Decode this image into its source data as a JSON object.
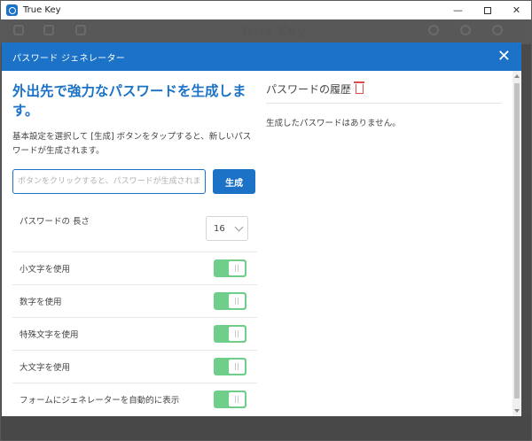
{
  "window": {
    "title": "True Key"
  },
  "background": {
    "logo_text": "True Key"
  },
  "dialog": {
    "title": "パスワード ジェネレーター",
    "heading": "外出先で強力なパスワードを生成します。",
    "description": "基本設定を選択して [生成] ボタンをタップすると、新しいパスワードが生成されます。",
    "input_placeholder": "ボタンをクリックすると、パスワードが生成されます",
    "generate_label": "生成",
    "length": {
      "label": "パスワードの 長さ",
      "value": "16"
    },
    "options": [
      {
        "label": "小文字を使用",
        "enabled": true
      },
      {
        "label": "数字を使用",
        "enabled": true
      },
      {
        "label": "特殊文字を使用",
        "enabled": true
      },
      {
        "label": "大文字を使用",
        "enabled": true
      },
      {
        "label": "フォームにジェネレーターを自動的に表示",
        "enabled": true
      }
    ],
    "history": {
      "title": "パスワードの履歴",
      "empty_text": "生成したパスワードはありません。"
    }
  },
  "colors": {
    "accent": "#1b72c6",
    "toggle_on": "#6fcf8a",
    "danger": "#e04848"
  }
}
